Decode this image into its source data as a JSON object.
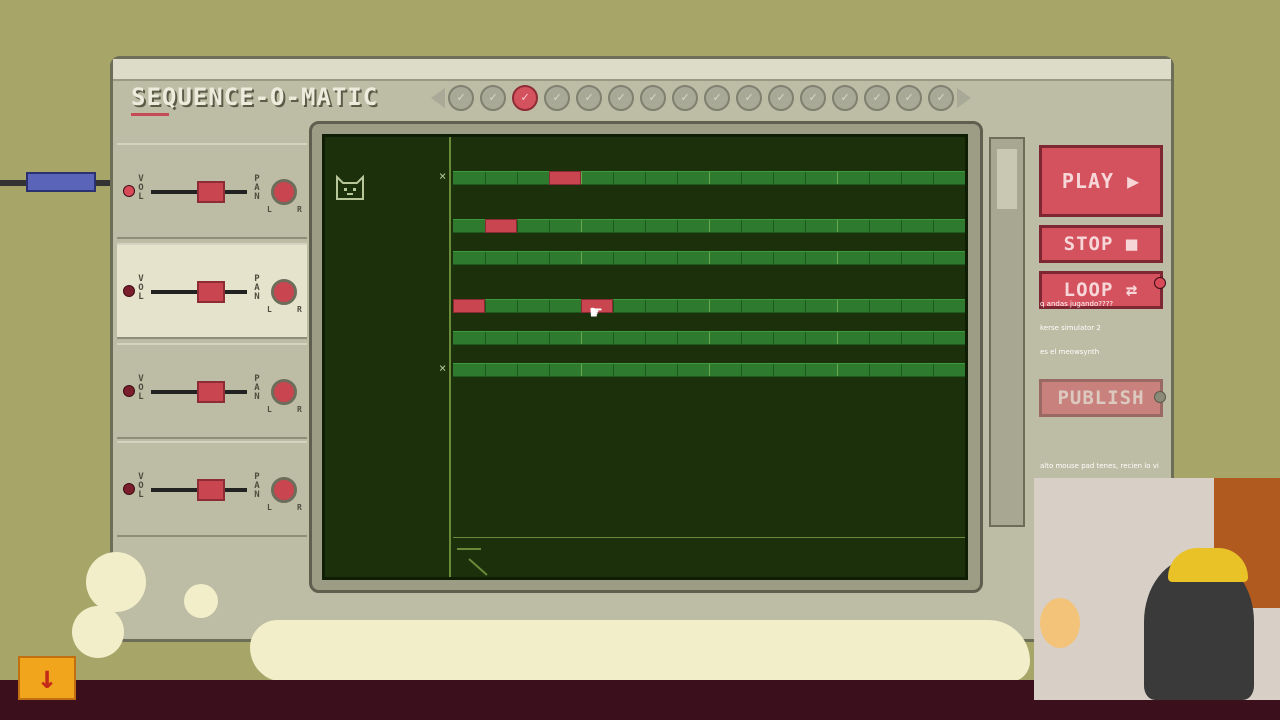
{
  "app": {
    "logo": "SEQUENCE-O-MATIC"
  },
  "colors": {
    "note": "#c9454f",
    "lane": "#2e7a2e",
    "screen_bg": "#1c300b",
    "button": "#d4525e",
    "background": "#a7a668"
  },
  "steps": {
    "count": 16,
    "active_index": 2
  },
  "channels": [
    {
      "vol_label": "VOL",
      "pan_label": "PAN",
      "l": "L",
      "r": "R",
      "led_on": true,
      "highlighted": false
    },
    {
      "vol_label": "VOL",
      "pan_label": "PAN",
      "l": "L",
      "r": "R",
      "led_on": false,
      "highlighted": true
    },
    {
      "vol_label": "VOL",
      "pan_label": "PAN",
      "l": "L",
      "r": "R",
      "led_on": false,
      "highlighted": false
    },
    {
      "vol_label": "VOL",
      "pan_label": "PAN",
      "l": "L",
      "r": "R",
      "led_on": false,
      "highlighted": false
    }
  ],
  "grid": {
    "columns": 16,
    "rows": [
      {
        "notes": [
          3
        ]
      },
      {
        "notes": [
          1
        ]
      },
      {
        "notes": []
      },
      {
        "notes": [
          0,
          4
        ]
      },
      {
        "notes": []
      },
      {
        "notes": []
      }
    ]
  },
  "controls": {
    "play": "PLAY ▶",
    "stop": "STOP ■",
    "loop": "LOOP ⇄",
    "publish": "PUBLISH"
  },
  "track": {
    "close_symbol": "×",
    "icon": "cat-icon"
  },
  "chat": [
    {
      "user": "",
      "text": "q andas jugando????"
    },
    {
      "user": "",
      "text": "kerse simulator 2"
    },
    {
      "user": "",
      "text": "es el meowsynth"
    },
    {
      "user": "",
      "text": "alto mouse pad tenes, recien lo vi"
    }
  ],
  "download_icon": "download-arrow-icon"
}
